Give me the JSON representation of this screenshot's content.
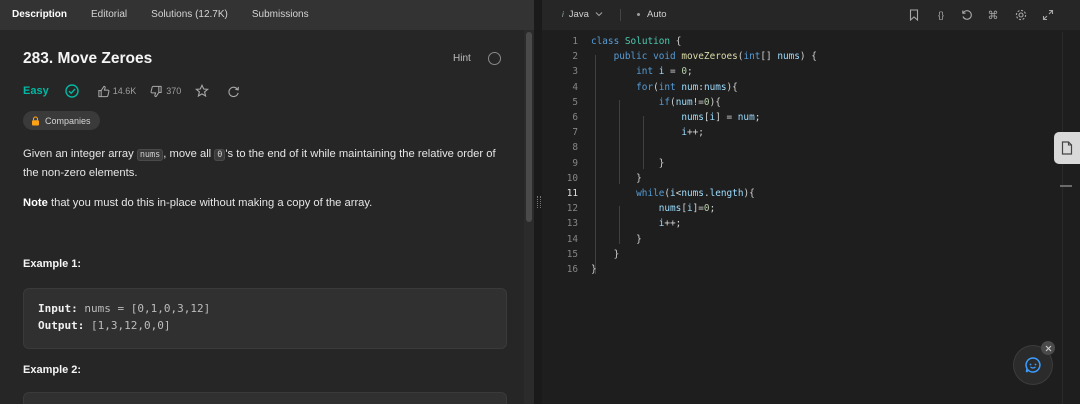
{
  "left_tabs": [
    "Description",
    "Editorial",
    "Solutions (12.7K)",
    "Submissions"
  ],
  "problem": {
    "title": "283. Move Zeroes",
    "hint_label": "Hint",
    "difficulty": "Easy",
    "likes": "14.6K",
    "dislikes": "370",
    "companies_label": "Companies",
    "description_part1": "Given an integer array ",
    "description_code1": "nums",
    "description_part2": ", move all ",
    "description_code2": "0",
    "description_part3": "'s to the end of it while maintaining the relative order of the non-zero elements.",
    "note_bold": "Note",
    "note_rest": " that you must do this in-place without making a copy of the array.",
    "example1_title": "Example 1:",
    "example1_input_label": "Input:",
    "example1_input_value": "nums = [0,1,0,3,12]",
    "example1_output_label": "Output:",
    "example1_output_value": "[1,3,12,0,0]",
    "example2_title": "Example 2:"
  },
  "editor_toolbar": {
    "language": "Java",
    "mode": "Auto"
  },
  "editor": {
    "current_line": 11,
    "lines": [
      {
        "n": "1",
        "text": "class Solution {"
      },
      {
        "n": "2",
        "text": "    public void moveZeroes(int[] nums) {"
      },
      {
        "n": "3",
        "text": "        int i = 0;"
      },
      {
        "n": "4",
        "text": "        for(int num:nums){"
      },
      {
        "n": "5",
        "text": "            if(num!=0){"
      },
      {
        "n": "6",
        "text": "                nums[i] = num;"
      },
      {
        "n": "7",
        "text": "                i++;"
      },
      {
        "n": "8",
        "text": ""
      },
      {
        "n": "9",
        "text": "            }"
      },
      {
        "n": "10",
        "text": "        }"
      },
      {
        "n": "11",
        "text": "        while(i<nums.length){"
      },
      {
        "n": "12",
        "text": "            nums[i]=0;"
      },
      {
        "n": "13",
        "text": "            i++;"
      },
      {
        "n": "14",
        "text": "        }"
      },
      {
        "n": "15",
        "text": "    }"
      },
      {
        "n": "16",
        "text": "}"
      }
    ]
  },
  "icons": {
    "like": "thumbs-up-icon",
    "dislike": "thumbs-down-icon",
    "star": "star-icon",
    "share": "share-icon",
    "solved": "check-circle-icon",
    "lock": "lock-icon"
  },
  "colors": {
    "easy": "#00b8a3",
    "panel_bg": "#262626",
    "editor_bg": "#1e1e1e",
    "accent_blue": "#3b9cff"
  }
}
